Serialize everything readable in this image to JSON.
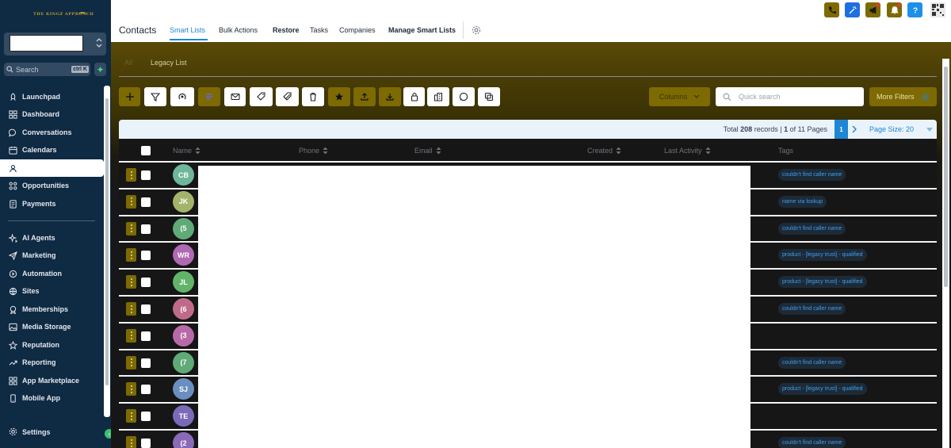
{
  "sidebar": {
    "logo_text": "THE KINGZ APPROACH",
    "search_placeholder": "Search",
    "search_shortcut": "ctrl K",
    "nav_group1": [
      {
        "label": "Launchpad",
        "icon": "rocket-icon"
      },
      {
        "label": "Dashboard",
        "icon": "grid-icon"
      },
      {
        "label": "Conversations",
        "icon": "chat-icon"
      },
      {
        "label": "Calendars",
        "icon": "calendar-icon"
      },
      {
        "label": "",
        "icon": "contacts-icon",
        "active": true
      },
      {
        "label": "Opportunities",
        "icon": "opportunities-icon"
      },
      {
        "label": "Payments",
        "icon": "payments-icon"
      }
    ],
    "nav_group2": [
      {
        "label": "AI Agents",
        "icon": "sparkle-icon"
      },
      {
        "label": "Marketing",
        "icon": "send-icon"
      },
      {
        "label": "Automation",
        "icon": "automation-icon"
      },
      {
        "label": "Sites",
        "icon": "globe-icon"
      },
      {
        "label": "Memberships",
        "icon": "membership-icon"
      },
      {
        "label": "Media Storage",
        "icon": "image-icon"
      },
      {
        "label": "Reputation",
        "icon": "star-icon"
      },
      {
        "label": "Reporting",
        "icon": "trend-icon"
      },
      {
        "label": "App Marketplace",
        "icon": "apps-icon"
      },
      {
        "label": "Mobile App",
        "icon": "mobile-icon"
      }
    ],
    "settings_label": "Settings"
  },
  "header": {
    "title": "Contacts",
    "tabs": [
      {
        "label": "Smart Lists",
        "active": true,
        "bold": false
      },
      {
        "label": "Bulk Actions",
        "active": false,
        "bold": false
      },
      {
        "label": "Restore",
        "active": false,
        "bold": true
      },
      {
        "label": "Tasks",
        "active": false,
        "bold": false
      },
      {
        "label": "Companies",
        "active": false,
        "bold": false
      },
      {
        "label": "Manage Smart Lists",
        "active": false,
        "bold": true
      }
    ],
    "icons": [
      {
        "name": "phone-icon",
        "color": "#7d6a02"
      },
      {
        "name": "magic-icon",
        "color": "#1e6fe0"
      },
      {
        "name": "megaphone-icon",
        "color": "#7d6a02"
      },
      {
        "name": "bell-icon",
        "color": "#7d6a02"
      },
      {
        "name": "help-icon",
        "color": "#1e90e8"
      }
    ]
  },
  "subtabs": [
    {
      "label": "All",
      "active": true
    },
    {
      "label": "Legacy List",
      "active": false
    }
  ],
  "toolbar": {
    "columns_label": "Columns",
    "quick_search_placeholder": "Quick search",
    "more_filters_label": "More Filters"
  },
  "pagination": {
    "total_label": "Total",
    "total_records": "208",
    "records_suffix": "records |",
    "current_page": "1",
    "of_pages_text": "of 11 Pages",
    "page_size_label": "Page Size: 20"
  },
  "table": {
    "columns": [
      "Name",
      "Phone",
      "Email",
      "Created",
      "Last Activity",
      "Tags"
    ],
    "rows": [
      {
        "initials": "CB",
        "color": "#6fb79a",
        "tag": "couldn't find caller name"
      },
      {
        "initials": "JK",
        "color": "#a3b46a",
        "tag": "name via lookup"
      },
      {
        "initials": "(5",
        "color": "#5faa77",
        "tag": "couldn't find caller name"
      },
      {
        "initials": "WR",
        "color": "#b06ab3",
        "tag": "product - [legacy trust] - qualified"
      },
      {
        "initials": "JL",
        "color": "#62b46a",
        "tag": "product - [legacy trust] - qualified"
      },
      {
        "initials": "(6",
        "color": "#c06a8a",
        "tag": "couldn't find caller name"
      },
      {
        "initials": "(3",
        "color": "#b86aa8",
        "tag": ""
      },
      {
        "initials": "(7",
        "color": "#5faa77",
        "tag": "couldn't find caller name"
      },
      {
        "initials": "SJ",
        "color": "#6a8ebf",
        "tag": "product - [legacy trust] - qualified"
      },
      {
        "initials": "TE",
        "color": "#7a6ab8",
        "tag": ""
      },
      {
        "initials": "(2",
        "color": "#8a6ab8",
        "tag": "couldn't find caller name"
      }
    ]
  }
}
